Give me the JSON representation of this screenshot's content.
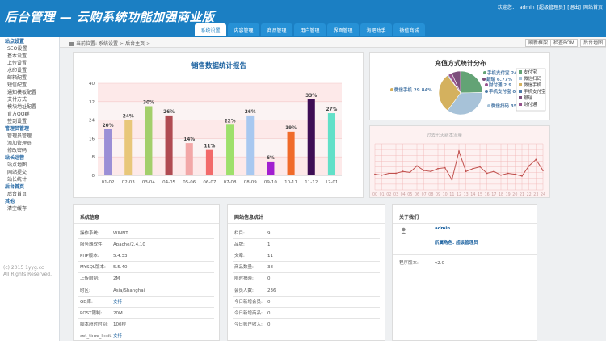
{
  "header": {
    "logo": "后台管理 — 云购系统功能加强商业版",
    "welcome": "欢迎您：",
    "user": "admin",
    "role": "[超级管理员]",
    "logout": "[退出]",
    "home_link": "网站首页"
  },
  "tabs": [
    {
      "label": "系统设置",
      "active": true
    },
    {
      "label": "内容管理"
    },
    {
      "label": "商品管理"
    },
    {
      "label": "用户管理"
    },
    {
      "label": "界面管理"
    },
    {
      "label": "淘吧助手"
    },
    {
      "label": "微信商城"
    }
  ],
  "sidebar": {
    "groups": [
      {
        "title": "站点设置",
        "items": [
          "SEO设置",
          "基本设置",
          "上传设置",
          "水印设置",
          "邮箱配置",
          "短信配置",
          "通知模板配置",
          "支付方式",
          "模块地址配置",
          "官方QQ群",
          "签到设置"
        ]
      },
      {
        "title": "管理员管理",
        "items": [
          "管理员管理",
          "添加管理员",
          "修改密码"
        ]
      },
      {
        "title": "站长运营",
        "items": [
          "站点地图",
          "网站提交",
          "站长统计"
        ]
      },
      {
        "title": "后台首页",
        "items": [
          "后台首页"
        ]
      },
      {
        "title": "其他",
        "items": [
          "清空缓存"
        ]
      }
    ],
    "copyright": "(c) 2015 1yyg.cc\nAll Rights Reserved."
  },
  "breadcrumb": {
    "location": "当前位置:",
    "section": "系统设置",
    "sep": ">",
    "page": "后台主页",
    "sep2": ">"
  },
  "toolbar": {
    "refresh": "刷新框架",
    "bom": "检查BOM",
    "map": "后台地图"
  },
  "charts": {
    "sales": {
      "type": "bar",
      "title": "销售数据统计报告",
      "categories": [
        "01-02",
        "02-03",
        "03-04",
        "04-05",
        "05-06",
        "06-07",
        "07-08",
        "08-09",
        "09-10",
        "10-11",
        "11-12",
        "12-01"
      ],
      "values": [
        20,
        24,
        30,
        26,
        14,
        11,
        22,
        26,
        6,
        19,
        33,
        27
      ],
      "labels": [
        "20%",
        "24%",
        "30%",
        "26%",
        "14%",
        "11%",
        "22%",
        "26%",
        "6%",
        "19%",
        "33%",
        "27%"
      ],
      "colors": [
        "#9b8fd6",
        "#e8c77a",
        "#a3cf6b",
        "#b04b52",
        "#f2a7a7",
        "#f26a6a",
        "#9ee06b",
        "#a8c8f0",
        "#a21fd0",
        "#f06a2a",
        "#3e0e55",
        "#62e0c8"
      ],
      "ylim": [
        0,
        40
      ],
      "yticks": [
        0,
        8,
        16,
        24,
        32,
        40
      ]
    },
    "pay": {
      "type": "pie",
      "title": "充值方式统计分布",
      "slices": [
        {
          "name": "支付宝",
          "label": "手机支付宝 24.88",
          "value": 24.88,
          "color": "#63a375"
        },
        {
          "name": "微信扫码",
          "label": "微信扫码 35.75",
          "value": 35.75,
          "color": "#a7c2d8"
        },
        {
          "name": "微信手机",
          "label": "微信手机 29.84%",
          "value": 29.84,
          "color": "#d4b15e"
        },
        {
          "name": "手机支付宝",
          "label": "手机支付宝 0.7",
          "value": 0.7,
          "color": "#4e7ba8"
        },
        {
          "name": "财付通",
          "label": "财付通 2.9",
          "value": 2.9,
          "color": "#96528c"
        },
        {
          "name": "銀瑞",
          "label": "銀瑞 6.77%",
          "value": 6.77,
          "color": "#7c4f7c"
        }
      ],
      "legend": [
        "支付宝",
        "微信扫码",
        "微信手机",
        "手机支付宝",
        "銀瑞",
        "财付通"
      ]
    },
    "traffic": {
      "type": "line",
      "title": "过去七天新本流量",
      "x": [
        "00",
        "01",
        "02",
        "03",
        "04",
        "05",
        "06",
        "07",
        "08",
        "09",
        "10",
        "11",
        "12",
        "13",
        "14",
        "15",
        "16",
        "17",
        "18",
        "19",
        "20",
        "21",
        "22",
        "23",
        "24"
      ],
      "values": [
        34,
        32,
        36,
        36,
        40,
        38,
        52,
        42,
        40,
        46,
        48,
        22,
        84,
        40,
        46,
        50,
        36,
        40,
        32,
        36,
        34,
        30,
        52,
        66,
        42
      ]
    }
  },
  "sysinfo": {
    "title": "系统信息",
    "rows": [
      {
        "k": "操作系统:",
        "v": "WINNT"
      },
      {
        "k": "服务器软件:",
        "v": "Apache/2.4.10"
      },
      {
        "k": "PHP版本:",
        "v": "5.4.33"
      },
      {
        "k": "MYSQL版本:",
        "v": "5.5.40"
      },
      {
        "k": "上传限制:",
        "v": "2M"
      },
      {
        "k": "时区:",
        "v": "Asia/Shanghai"
      },
      {
        "k": "GD库:",
        "v": "支持"
      },
      {
        "k": "POST限制:",
        "v": "20M"
      },
      {
        "k": "脚本超时时间:",
        "v": "100秒"
      },
      {
        "k": "set_time_limit:",
        "v": "支持"
      }
    ]
  },
  "sitestats": {
    "title": "网站信息统计",
    "rows": [
      {
        "k": "栏目:",
        "v": "9"
      },
      {
        "k": "品牌:",
        "v": "1"
      },
      {
        "k": "文章:",
        "v": "11"
      },
      {
        "k": "商品数量:",
        "v": "38"
      },
      {
        "k": "限时揭晓:",
        "v": "0"
      },
      {
        "k": "会员人数:",
        "v": "236"
      },
      {
        "k": "今日新增会员:",
        "v": "0"
      },
      {
        "k": "今日新增商品:",
        "v": "0"
      },
      {
        "k": "今日账户收入:",
        "v": "0"
      }
    ]
  },
  "about": {
    "title": "关于我们",
    "name": "admin",
    "role_label": "所属角色: 超级管理员",
    "version_label": "程序版本:",
    "version": "v2.0"
  }
}
